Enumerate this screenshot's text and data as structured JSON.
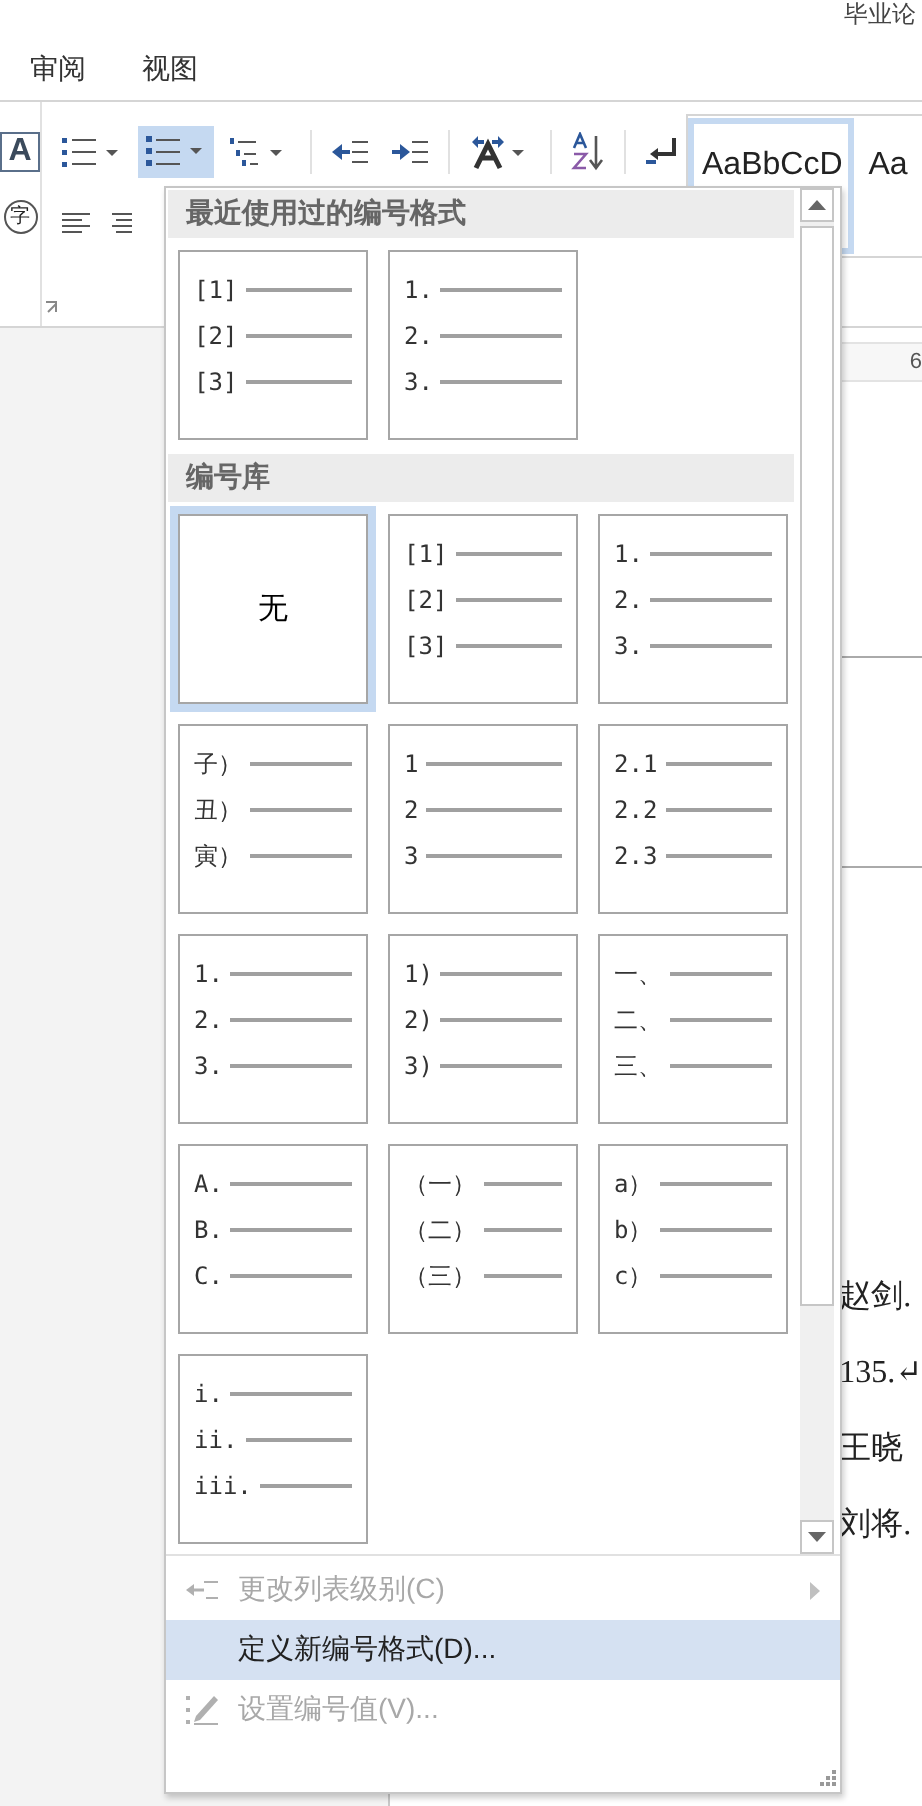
{
  "window": {
    "title": "毕业论"
  },
  "tabs": [
    {
      "label": "审阅",
      "selected": false
    },
    {
      "label": "视图",
      "selected": false
    }
  ],
  "ribbon": {
    "font_glyphs": [
      "A",
      "字"
    ],
    "numbering_button": {
      "selected": true
    },
    "styles": [
      {
        "label": "AaBbCcD",
        "selected": true
      },
      {
        "label": "Aa",
        "selected": false
      }
    ]
  },
  "ruler": {
    "label": "6"
  },
  "document": {
    "lines": [
      "赵剑.",
      "135.↵",
      "王晓",
      "刘将."
    ]
  },
  "numbering_menu": {
    "sections": [
      {
        "title": "最近使用过的编号格式",
        "tiles": [
          {
            "kind": "list",
            "markers": [
              "[1]",
              "[2]",
              "[3]"
            ],
            "selected": false
          },
          {
            "kind": "list",
            "markers": [
              "1.",
              "2.",
              "3."
            ],
            "selected": false
          }
        ]
      },
      {
        "title": "编号库",
        "tiles": [
          {
            "kind": "none",
            "label": "无",
            "selected": true
          },
          {
            "kind": "list",
            "markers": [
              "[1]",
              "[2]",
              "[3]"
            ],
            "selected": false
          },
          {
            "kind": "list",
            "markers": [
              "1.",
              "2.",
              "3."
            ],
            "selected": false
          },
          {
            "kind": "list",
            "markers": [
              "子）",
              "丑）",
              "寅）"
            ],
            "selected": false
          },
          {
            "kind": "list",
            "markers": [
              "1",
              "2",
              "3"
            ],
            "selected": false
          },
          {
            "kind": "list",
            "markers": [
              "2.1",
              "2.2",
              "2.3"
            ],
            "selected": false
          },
          {
            "kind": "list",
            "markers": [
              "1.",
              "2.",
              "3."
            ],
            "selected": false
          },
          {
            "kind": "list",
            "markers": [
              "1)",
              "2)",
              "3)"
            ],
            "selected": false
          },
          {
            "kind": "list",
            "markers": [
              "一、",
              "二、",
              "三、"
            ],
            "selected": false
          },
          {
            "kind": "list",
            "markers": [
              "A.",
              "B.",
              "C."
            ],
            "selected": false
          },
          {
            "kind": "list",
            "markers": [
              "（一）",
              "（二）",
              "（三）"
            ],
            "selected": false
          },
          {
            "kind": "list",
            "markers": [
              "a）",
              "b）",
              "c）"
            ],
            "selected": false
          },
          {
            "kind": "list",
            "markers": [
              "i.",
              "ii.",
              "iii."
            ],
            "selected": false
          }
        ]
      }
    ],
    "commands": [
      {
        "kind": "level",
        "label": "更改列表级别(C)",
        "disabled": true,
        "highlighted": false,
        "submenu": true
      },
      {
        "kind": "define",
        "label": "定义新编号格式(D)...",
        "disabled": false,
        "highlighted": true,
        "submenu": false
      },
      {
        "kind": "value",
        "label": "设置编号值(V)...",
        "disabled": true,
        "highlighted": false,
        "submenu": false
      }
    ]
  }
}
